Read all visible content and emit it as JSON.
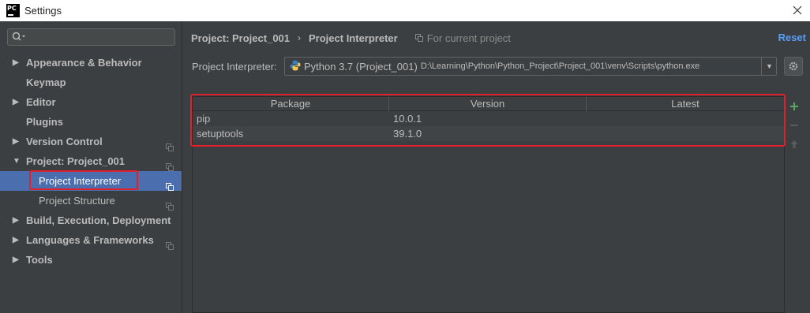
{
  "window": {
    "title": "Settings"
  },
  "sidebar": {
    "search_placeholder": "",
    "items": [
      {
        "label": "Appearance & Behavior"
      },
      {
        "label": "Keymap"
      },
      {
        "label": "Editor"
      },
      {
        "label": "Plugins"
      },
      {
        "label": "Version Control"
      },
      {
        "label": "Project: Project_001"
      },
      {
        "label": "Project Interpreter"
      },
      {
        "label": "Project Structure"
      },
      {
        "label": "Build, Execution, Deployment"
      },
      {
        "label": "Languages & Frameworks"
      },
      {
        "label": "Tools"
      }
    ]
  },
  "breadcrumb": {
    "project": "Project: Project_001",
    "page": "Project Interpreter",
    "scope": "For current project"
  },
  "reset_label": "Reset",
  "interpreter": {
    "label": "Project Interpreter:",
    "name": "Python 3.7 (Project_001)",
    "path": "D:\\Learning\\Python\\Python_Project\\Project_001\\venv\\Scripts\\python.exe"
  },
  "packages": {
    "columns": [
      "Package",
      "Version",
      "Latest"
    ],
    "rows": [
      {
        "package": "pip",
        "version": "10.0.1",
        "latest": ""
      },
      {
        "package": "setuptools",
        "version": "39.1.0",
        "latest": ""
      }
    ]
  },
  "colors": {
    "accent": "#4b6eaf",
    "highlight_outline": "#e0202a",
    "link": "#589df6",
    "add": "#59a869"
  }
}
